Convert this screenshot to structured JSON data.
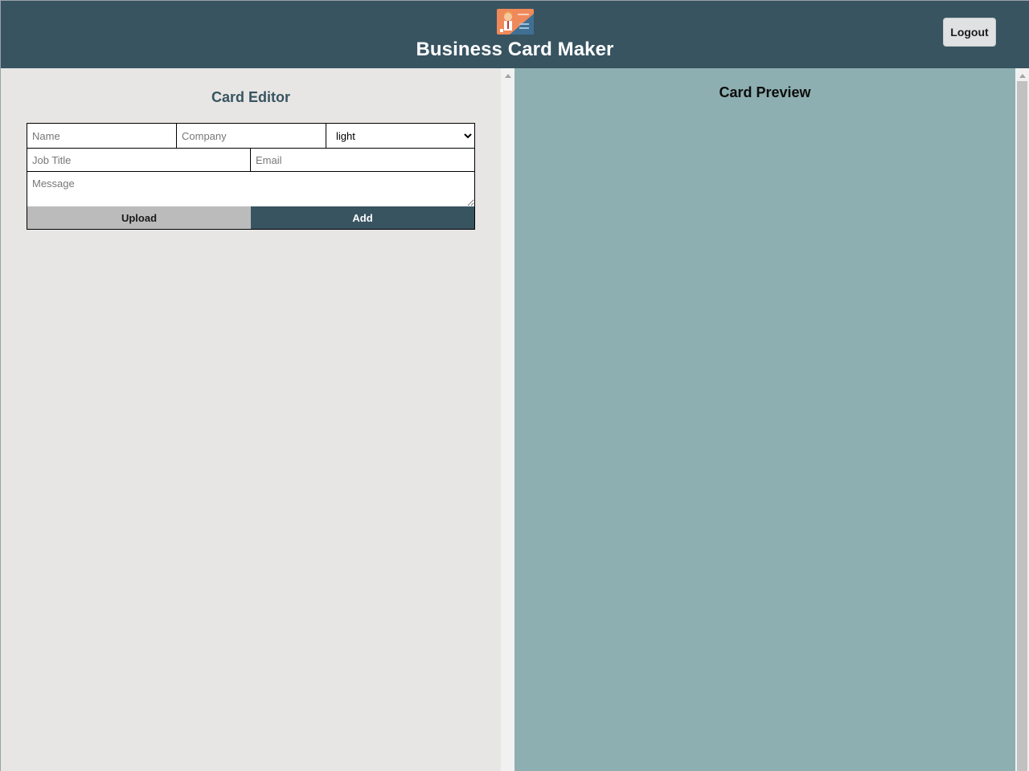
{
  "header": {
    "title": "Business Card Maker",
    "logout_label": "Logout",
    "logo_icon": "business-card-logo-icon",
    "bg_color": "#385461"
  },
  "editor": {
    "title": "Card Editor",
    "fields": {
      "name_placeholder": "Name",
      "company_placeholder": "Company",
      "theme_selected": "light",
      "job_title_placeholder": "Job Title",
      "email_placeholder": "Email",
      "message_placeholder": "Message"
    },
    "upload_label": "Upload",
    "add_label": "Add"
  },
  "preview": {
    "title": "Card Preview",
    "bg_color": "#8eafb1"
  }
}
